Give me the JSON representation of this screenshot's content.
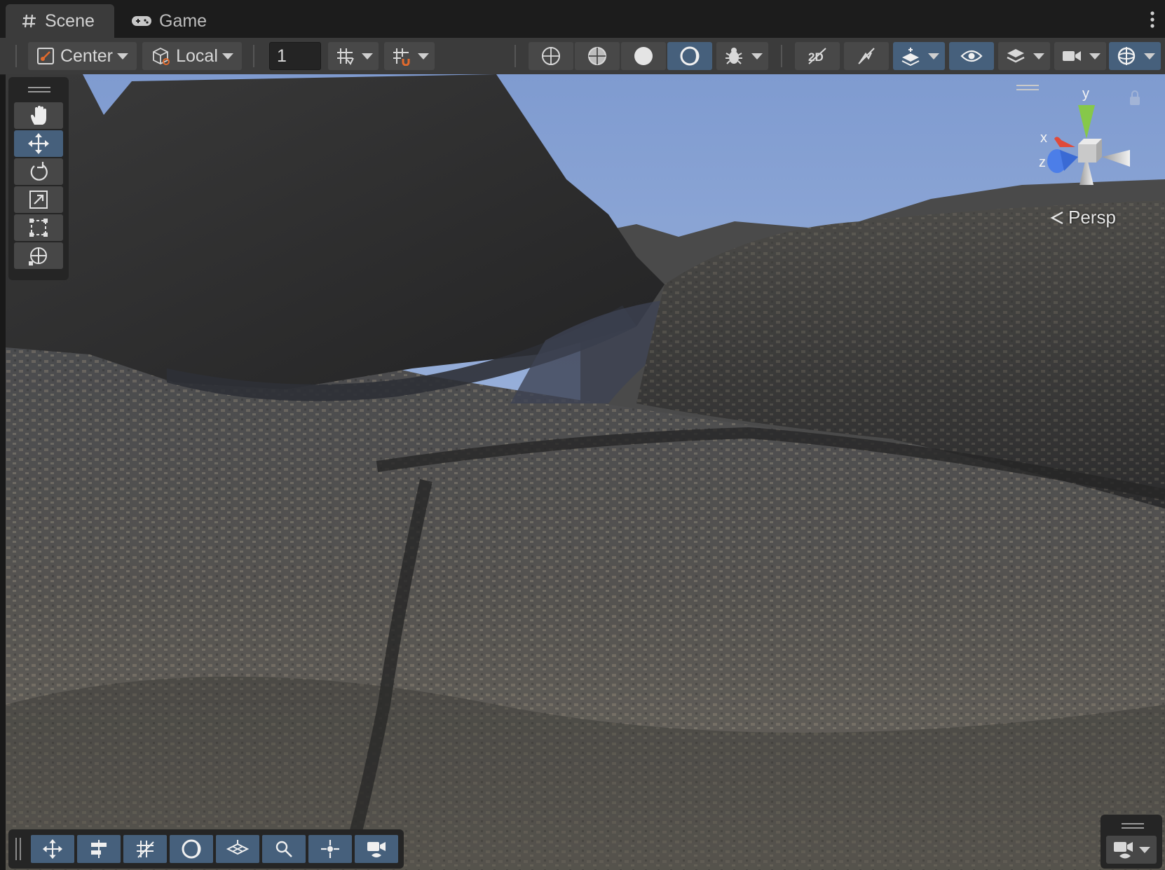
{
  "tabs": [
    {
      "label": "Scene",
      "icon": "hash-icon",
      "active": true
    },
    {
      "label": "Game",
      "icon": "gamepad-icon",
      "active": false
    }
  ],
  "toolbar": {
    "pivot_mode": "Center",
    "pivot_rotation": "Local",
    "snap_increment": "1"
  },
  "tools": [
    "hand-tool",
    "move-tool",
    "rotate-tool",
    "scale-tool",
    "rect-tool",
    "transform-tool"
  ],
  "gizmo": {
    "x_label": "x",
    "y_label": "y",
    "z_label": "z",
    "projection": "Persp"
  },
  "colors": {
    "accent_active": "#46607c",
    "panel": "#3b3b3b",
    "sky_top": "#7f9bd0",
    "sky_horizon": "#b6c8e6",
    "terrain": "#3e3e3e"
  }
}
